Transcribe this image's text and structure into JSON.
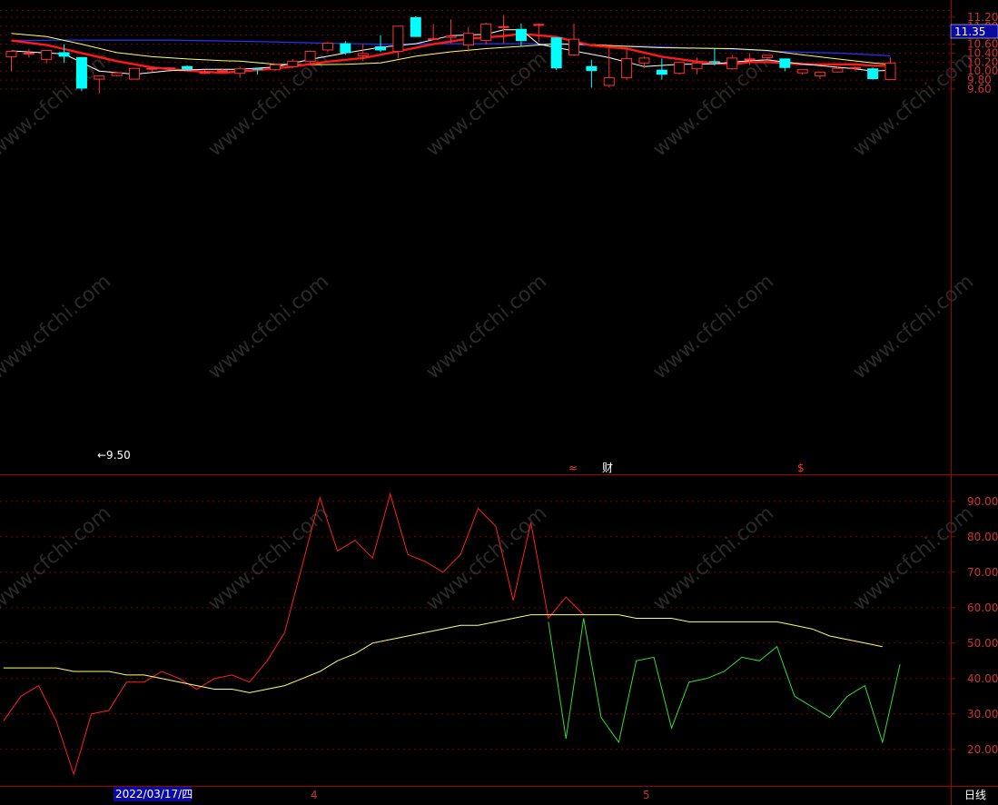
{
  "price_panel": {
    "current_price_label": "11.35",
    "low_marker": "←9.50",
    "event_markers": [
      {
        "text": "≈",
        "color": "#ff4040"
      },
      {
        "text": "财",
        "color": "#ffffff"
      },
      {
        "text": "$",
        "color": "#ff3030"
      }
    ],
    "yticks": [
      "11.20",
      "11.00",
      "10.80",
      "10.60",
      "10.40",
      "10.20",
      "10.00",
      "9.80",
      "9.60"
    ]
  },
  "indicator_panel": {
    "yticks": [
      "90.00",
      "80.00",
      "70.00",
      "60.00",
      "50.00",
      "40.00",
      "30.00",
      "20.00"
    ]
  },
  "time_axis": {
    "date_label": "2022/03/17/四",
    "month_labels": [
      "4",
      "5"
    ],
    "period_label": "日线"
  },
  "watermark": "www.cfchi.com",
  "colors": {
    "up": "#ff3030",
    "down": "#00ffff",
    "ma5": "#ffffff",
    "ma10": "#ff1a1a",
    "ma20": "#ffff66",
    "ma60": "#2233ff",
    "rsi_up": "#ff2020",
    "rsi_down": "#33dd33",
    "rsi_ma": "#ffff66",
    "axis": "#a00000"
  },
  "chart_data": [
    {
      "type": "candlestick",
      "title": "",
      "ylim": [
        9.42,
        11.35
      ],
      "candles": [
        {
          "o": 10.32,
          "h": 10.4,
          "l": 10.0,
          "c": 10.44
        },
        {
          "o": 10.4,
          "h": 10.49,
          "l": 10.3,
          "c": 10.4
        },
        {
          "o": 10.26,
          "h": 10.47,
          "l": 10.17,
          "c": 10.46
        },
        {
          "o": 10.42,
          "h": 10.6,
          "l": 10.18,
          "c": 10.32
        },
        {
          "o": 10.31,
          "h": 10.31,
          "l": 9.55,
          "c": 9.61
        },
        {
          "o": 9.82,
          "h": 9.9,
          "l": 9.5,
          "c": 9.89
        },
        {
          "o": 9.9,
          "h": 9.99,
          "l": 9.88,
          "c": 9.96
        },
        {
          "o": 9.82,
          "h": 10.06,
          "l": 9.82,
          "c": 10.06
        },
        {
          "o": 10.05,
          "h": 10.1,
          "l": 9.98,
          "c": 10.06
        },
        {
          "o": 10.06,
          "h": 10.08,
          "l": 10.01,
          "c": 10.07
        },
        {
          "o": 10.11,
          "h": 10.13,
          "l": 10.04,
          "c": 10.04
        },
        {
          "o": 9.96,
          "h": 10.03,
          "l": 9.93,
          "c": 9.97
        },
        {
          "o": 10.0,
          "h": 10.05,
          "l": 9.95,
          "c": 10.01
        },
        {
          "o": 9.95,
          "h": 10.1,
          "l": 9.85,
          "c": 10.05
        },
        {
          "o": 10.06,
          "h": 10.07,
          "l": 9.92,
          "c": 10.03
        },
        {
          "o": 10.03,
          "h": 10.17,
          "l": 10.0,
          "c": 10.14
        },
        {
          "o": 10.1,
          "h": 10.27,
          "l": 10.07,
          "c": 10.22
        },
        {
          "o": 10.22,
          "h": 10.46,
          "l": 10.15,
          "c": 10.44
        },
        {
          "o": 10.47,
          "h": 10.65,
          "l": 10.42,
          "c": 10.62
        },
        {
          "o": 10.62,
          "h": 10.67,
          "l": 10.36,
          "c": 10.4
        },
        {
          "o": 10.34,
          "h": 10.6,
          "l": 10.22,
          "c": 10.39
        },
        {
          "o": 10.55,
          "h": 10.8,
          "l": 10.42,
          "c": 10.46
        },
        {
          "o": 10.44,
          "h": 10.82,
          "l": 10.28,
          "c": 11.0
        },
        {
          "o": 11.2,
          "h": 11.22,
          "l": 10.76,
          "c": 10.76
        },
        {
          "o": 10.7,
          "h": 11.05,
          "l": 10.68,
          "c": 10.72
        },
        {
          "o": 10.75,
          "h": 11.15,
          "l": 10.62,
          "c": 10.78
        },
        {
          "o": 10.58,
          "h": 10.98,
          "l": 10.43,
          "c": 10.84
        },
        {
          "o": 10.68,
          "h": 11.08,
          "l": 10.6,
          "c": 11.05
        },
        {
          "o": 10.98,
          "h": 11.25,
          "l": 10.62,
          "c": 10.99
        },
        {
          "o": 10.94,
          "h": 11.06,
          "l": 10.56,
          "c": 10.67
        },
        {
          "o": 11.02,
          "h": 11.06,
          "l": 10.65,
          "c": 11.04
        },
        {
          "o": 10.75,
          "h": 10.75,
          "l": 10.02,
          "c": 10.06
        },
        {
          "o": 10.36,
          "h": 11.06,
          "l": 10.33,
          "c": 10.71
        },
        {
          "o": 10.11,
          "h": 10.25,
          "l": 9.63,
          "c": 10.0
        },
        {
          "o": 9.68,
          "h": 10.52,
          "l": 9.63,
          "c": 9.85
        },
        {
          "o": 9.85,
          "h": 10.52,
          "l": 9.8,
          "c": 10.28
        },
        {
          "o": 10.18,
          "h": 10.33,
          "l": 10.07,
          "c": 10.29
        },
        {
          "o": 10.03,
          "h": 10.28,
          "l": 9.81,
          "c": 9.92
        },
        {
          "o": 9.95,
          "h": 10.21,
          "l": 9.92,
          "c": 10.19
        },
        {
          "o": 10.05,
          "h": 10.3,
          "l": 9.93,
          "c": 10.18
        },
        {
          "o": 10.22,
          "h": 10.5,
          "l": 10.12,
          "c": 10.19
        },
        {
          "o": 10.05,
          "h": 10.36,
          "l": 10.03,
          "c": 10.29
        },
        {
          "o": 10.25,
          "h": 10.4,
          "l": 10.13,
          "c": 10.27
        },
        {
          "o": 10.3,
          "h": 10.36,
          "l": 10.25,
          "c": 10.35
        },
        {
          "o": 10.28,
          "h": 10.28,
          "l": 10.0,
          "c": 10.07
        },
        {
          "o": 9.96,
          "h": 10.04,
          "l": 9.92,
          "c": 10.03
        },
        {
          "o": 9.89,
          "h": 9.99,
          "l": 9.82,
          "c": 9.97
        },
        {
          "o": 9.98,
          "h": 10.1,
          "l": 9.97,
          "c": 10.06
        },
        {
          "o": 10.06,
          "h": 10.1,
          "l": 10.01,
          "c": 10.08
        },
        {
          "o": 10.06,
          "h": 10.08,
          "l": 9.81,
          "c": 9.82
        },
        {
          "o": 9.81,
          "h": 10.3,
          "l": 9.8,
          "c": 10.18
        }
      ],
      "ma5": [
        [
          0,
          10.45
        ],
        [
          3,
          10.38
        ],
        [
          5,
          10.0
        ],
        [
          7,
          9.93
        ],
        [
          9,
          10.01
        ],
        [
          11,
          10.04
        ],
        [
          13,
          10.04
        ],
        [
          15,
          10.09
        ],
        [
          17,
          10.26
        ],
        [
          19,
          10.4
        ],
        [
          21,
          10.53
        ],
        [
          23,
          10.61
        ],
        [
          25,
          10.79
        ],
        [
          27,
          10.82
        ],
        [
          28,
          10.92
        ],
        [
          29,
          10.92
        ],
        [
          30,
          10.6
        ],
        [
          32,
          10.45
        ],
        [
          34,
          10.3
        ],
        [
          36,
          10.1
        ],
        [
          38,
          10.15
        ],
        [
          40,
          10.16
        ],
        [
          42,
          10.23
        ],
        [
          43,
          10.25
        ],
        [
          44,
          10.2
        ],
        [
          46,
          10.12
        ],
        [
          48,
          10.05
        ],
        [
          49,
          10.0
        ],
        [
          50,
          10.02
        ]
      ],
      "ma10": [
        [
          0,
          10.68
        ],
        [
          2,
          10.58
        ],
        [
          4,
          10.4
        ],
        [
          6,
          10.22
        ],
        [
          8,
          10.08
        ],
        [
          10,
          10.01
        ],
        [
          12,
          9.96
        ],
        [
          14,
          10.02
        ],
        [
          16,
          10.1
        ],
        [
          18,
          10.21
        ],
        [
          20,
          10.29
        ],
        [
          22,
          10.44
        ],
        [
          24,
          10.6
        ],
        [
          26,
          10.72
        ],
        [
          28,
          10.78
        ],
        [
          29,
          10.83
        ],
        [
          31,
          10.76
        ],
        [
          33,
          10.57
        ],
        [
          35,
          10.5
        ],
        [
          37,
          10.32
        ],
        [
          39,
          10.21
        ],
        [
          41,
          10.15
        ],
        [
          42,
          10.2
        ],
        [
          43,
          10.2
        ],
        [
          45,
          10.15
        ],
        [
          47,
          10.15
        ],
        [
          48,
          10.15
        ],
        [
          49,
          10.12
        ],
        [
          50,
          10.12
        ]
      ],
      "ma20": [
        [
          0,
          10.84
        ],
        [
          2,
          10.77
        ],
        [
          4,
          10.6
        ],
        [
          6,
          10.41
        ],
        [
          8,
          10.32
        ],
        [
          10,
          10.27
        ],
        [
          12,
          10.23
        ],
        [
          13,
          10.22
        ],
        [
          15,
          10.15
        ],
        [
          17,
          10.14
        ],
        [
          19,
          10.15
        ],
        [
          21,
          10.18
        ],
        [
          23,
          10.33
        ],
        [
          25,
          10.43
        ],
        [
          27,
          10.5
        ],
        [
          29,
          10.55
        ],
        [
          31,
          10.61
        ],
        [
          33,
          10.59
        ],
        [
          35,
          10.55
        ],
        [
          37,
          10.52
        ],
        [
          39,
          10.51
        ],
        [
          41,
          10.5
        ],
        [
          43,
          10.46
        ],
        [
          45,
          10.36
        ],
        [
          47,
          10.27
        ],
        [
          49,
          10.18
        ],
        [
          50,
          10.15
        ]
      ],
      "ma60": [
        [
          0,
          10.68
        ],
        [
          3,
          10.69
        ],
        [
          6,
          10.69
        ],
        [
          9,
          10.69
        ],
        [
          12,
          10.67
        ],
        [
          15,
          10.65
        ],
        [
          18,
          10.62
        ],
        [
          21,
          10.6
        ],
        [
          24,
          10.61
        ],
        [
          27,
          10.61
        ],
        [
          30,
          10.61
        ],
        [
          33,
          10.57
        ],
        [
          36,
          10.55
        ],
        [
          39,
          10.51
        ],
        [
          41,
          10.49
        ],
        [
          43,
          10.45
        ],
        [
          45,
          10.42
        ],
        [
          47,
          10.4
        ],
        [
          50,
          10.34
        ]
      ]
    },
    {
      "type": "line",
      "title": "",
      "ylim": [
        12,
        96
      ],
      "series": [
        {
          "values": [
            28,
            35,
            38,
            28,
            13,
            30,
            31,
            39,
            39,
            42,
            40,
            37,
            40,
            41,
            39,
            45,
            53,
            72,
            91,
            76,
            79,
            74,
            92,
            75,
            73,
            70,
            75,
            88,
            83,
            62,
            84,
            57,
            63,
            58,
            null,
            null,
            null,
            null,
            null,
            null,
            null,
            null,
            null,
            null,
            null,
            null,
            null,
            null,
            null,
            null,
            null
          ]
        },
        {
          "values": [
            null,
            null,
            null,
            null,
            null,
            null,
            null,
            null,
            null,
            null,
            null,
            null,
            null,
            null,
            null,
            null,
            null,
            null,
            null,
            null,
            null,
            null,
            null,
            null,
            null,
            null,
            null,
            null,
            null,
            null,
            null,
            56,
            23,
            57,
            29,
            22,
            45,
            46,
            26,
            39,
            40,
            42,
            46,
            45,
            49,
            35,
            32,
            29,
            35,
            38,
            22,
            44
          ]
        },
        {
          "values": [
            43,
            43,
            43,
            43,
            42,
            42,
            42,
            41,
            41,
            40,
            39,
            38,
            37,
            37,
            36,
            37,
            38,
            40,
            42,
            45,
            47,
            50,
            51,
            52,
            53,
            54,
            55,
            55,
            56,
            57,
            58,
            58,
            58,
            58,
            58,
            58,
            57,
            57,
            57,
            56,
            56,
            56,
            56,
            56,
            56,
            55,
            54,
            52,
            51,
            50,
            49
          ]
        }
      ]
    }
  ]
}
